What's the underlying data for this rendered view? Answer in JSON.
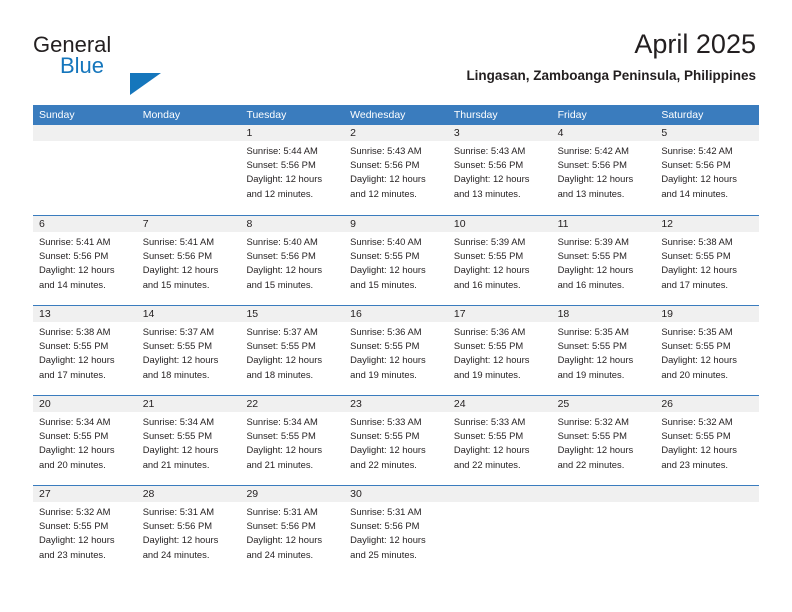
{
  "brand": {
    "name_part1": "General",
    "name_part2": "Blue",
    "accent_color": "#1576bc"
  },
  "header": {
    "title": "April 2025",
    "subtitle": "Lingasan, Zamboanga Peninsula, Philippines"
  },
  "theme": {
    "header_bar_color": "#3a7cbe",
    "day_band_color": "#f0f0f0",
    "text_color": "#231f20"
  },
  "weekdays": [
    "Sunday",
    "Monday",
    "Tuesday",
    "Wednesday",
    "Thursday",
    "Friday",
    "Saturday"
  ],
  "weeks": [
    [
      {
        "day": "",
        "lines": []
      },
      {
        "day": "",
        "lines": []
      },
      {
        "day": "1",
        "lines": [
          "Sunrise: 5:44 AM",
          "Sunset: 5:56 PM",
          "Daylight: 12 hours",
          "and 12 minutes."
        ]
      },
      {
        "day": "2",
        "lines": [
          "Sunrise: 5:43 AM",
          "Sunset: 5:56 PM",
          "Daylight: 12 hours",
          "and 12 minutes."
        ]
      },
      {
        "day": "3",
        "lines": [
          "Sunrise: 5:43 AM",
          "Sunset: 5:56 PM",
          "Daylight: 12 hours",
          "and 13 minutes."
        ]
      },
      {
        "day": "4",
        "lines": [
          "Sunrise: 5:42 AM",
          "Sunset: 5:56 PM",
          "Daylight: 12 hours",
          "and 13 minutes."
        ]
      },
      {
        "day": "5",
        "lines": [
          "Sunrise: 5:42 AM",
          "Sunset: 5:56 PM",
          "Daylight: 12 hours",
          "and 14 minutes."
        ]
      }
    ],
    [
      {
        "day": "6",
        "lines": [
          "Sunrise: 5:41 AM",
          "Sunset: 5:56 PM",
          "Daylight: 12 hours",
          "and 14 minutes."
        ]
      },
      {
        "day": "7",
        "lines": [
          "Sunrise: 5:41 AM",
          "Sunset: 5:56 PM",
          "Daylight: 12 hours",
          "and 15 minutes."
        ]
      },
      {
        "day": "8",
        "lines": [
          "Sunrise: 5:40 AM",
          "Sunset: 5:56 PM",
          "Daylight: 12 hours",
          "and 15 minutes."
        ]
      },
      {
        "day": "9",
        "lines": [
          "Sunrise: 5:40 AM",
          "Sunset: 5:55 PM",
          "Daylight: 12 hours",
          "and 15 minutes."
        ]
      },
      {
        "day": "10",
        "lines": [
          "Sunrise: 5:39 AM",
          "Sunset: 5:55 PM",
          "Daylight: 12 hours",
          "and 16 minutes."
        ]
      },
      {
        "day": "11",
        "lines": [
          "Sunrise: 5:39 AM",
          "Sunset: 5:55 PM",
          "Daylight: 12 hours",
          "and 16 minutes."
        ]
      },
      {
        "day": "12",
        "lines": [
          "Sunrise: 5:38 AM",
          "Sunset: 5:55 PM",
          "Daylight: 12 hours",
          "and 17 minutes."
        ]
      }
    ],
    [
      {
        "day": "13",
        "lines": [
          "Sunrise: 5:38 AM",
          "Sunset: 5:55 PM",
          "Daylight: 12 hours",
          "and 17 minutes."
        ]
      },
      {
        "day": "14",
        "lines": [
          "Sunrise: 5:37 AM",
          "Sunset: 5:55 PM",
          "Daylight: 12 hours",
          "and 18 minutes."
        ]
      },
      {
        "day": "15",
        "lines": [
          "Sunrise: 5:37 AM",
          "Sunset: 5:55 PM",
          "Daylight: 12 hours",
          "and 18 minutes."
        ]
      },
      {
        "day": "16",
        "lines": [
          "Sunrise: 5:36 AM",
          "Sunset: 5:55 PM",
          "Daylight: 12 hours",
          "and 19 minutes."
        ]
      },
      {
        "day": "17",
        "lines": [
          "Sunrise: 5:36 AM",
          "Sunset: 5:55 PM",
          "Daylight: 12 hours",
          "and 19 minutes."
        ]
      },
      {
        "day": "18",
        "lines": [
          "Sunrise: 5:35 AM",
          "Sunset: 5:55 PM",
          "Daylight: 12 hours",
          "and 19 minutes."
        ]
      },
      {
        "day": "19",
        "lines": [
          "Sunrise: 5:35 AM",
          "Sunset: 5:55 PM",
          "Daylight: 12 hours",
          "and 20 minutes."
        ]
      }
    ],
    [
      {
        "day": "20",
        "lines": [
          "Sunrise: 5:34 AM",
          "Sunset: 5:55 PM",
          "Daylight: 12 hours",
          "and 20 minutes."
        ]
      },
      {
        "day": "21",
        "lines": [
          "Sunrise: 5:34 AM",
          "Sunset: 5:55 PM",
          "Daylight: 12 hours",
          "and 21 minutes."
        ]
      },
      {
        "day": "22",
        "lines": [
          "Sunrise: 5:34 AM",
          "Sunset: 5:55 PM",
          "Daylight: 12 hours",
          "and 21 minutes."
        ]
      },
      {
        "day": "23",
        "lines": [
          "Sunrise: 5:33 AM",
          "Sunset: 5:55 PM",
          "Daylight: 12 hours",
          "and 22 minutes."
        ]
      },
      {
        "day": "24",
        "lines": [
          "Sunrise: 5:33 AM",
          "Sunset: 5:55 PM",
          "Daylight: 12 hours",
          "and 22 minutes."
        ]
      },
      {
        "day": "25",
        "lines": [
          "Sunrise: 5:32 AM",
          "Sunset: 5:55 PM",
          "Daylight: 12 hours",
          "and 22 minutes."
        ]
      },
      {
        "day": "26",
        "lines": [
          "Sunrise: 5:32 AM",
          "Sunset: 5:55 PM",
          "Daylight: 12 hours",
          "and 23 minutes."
        ]
      }
    ],
    [
      {
        "day": "27",
        "lines": [
          "Sunrise: 5:32 AM",
          "Sunset: 5:55 PM",
          "Daylight: 12 hours",
          "and 23 minutes."
        ]
      },
      {
        "day": "28",
        "lines": [
          "Sunrise: 5:31 AM",
          "Sunset: 5:56 PM",
          "Daylight: 12 hours",
          "and 24 minutes."
        ]
      },
      {
        "day": "29",
        "lines": [
          "Sunrise: 5:31 AM",
          "Sunset: 5:56 PM",
          "Daylight: 12 hours",
          "and 24 minutes."
        ]
      },
      {
        "day": "30",
        "lines": [
          "Sunrise: 5:31 AM",
          "Sunset: 5:56 PM",
          "Daylight: 12 hours",
          "and 25 minutes."
        ]
      },
      {
        "day": "",
        "lines": []
      },
      {
        "day": "",
        "lines": []
      },
      {
        "day": "",
        "lines": []
      }
    ]
  ]
}
